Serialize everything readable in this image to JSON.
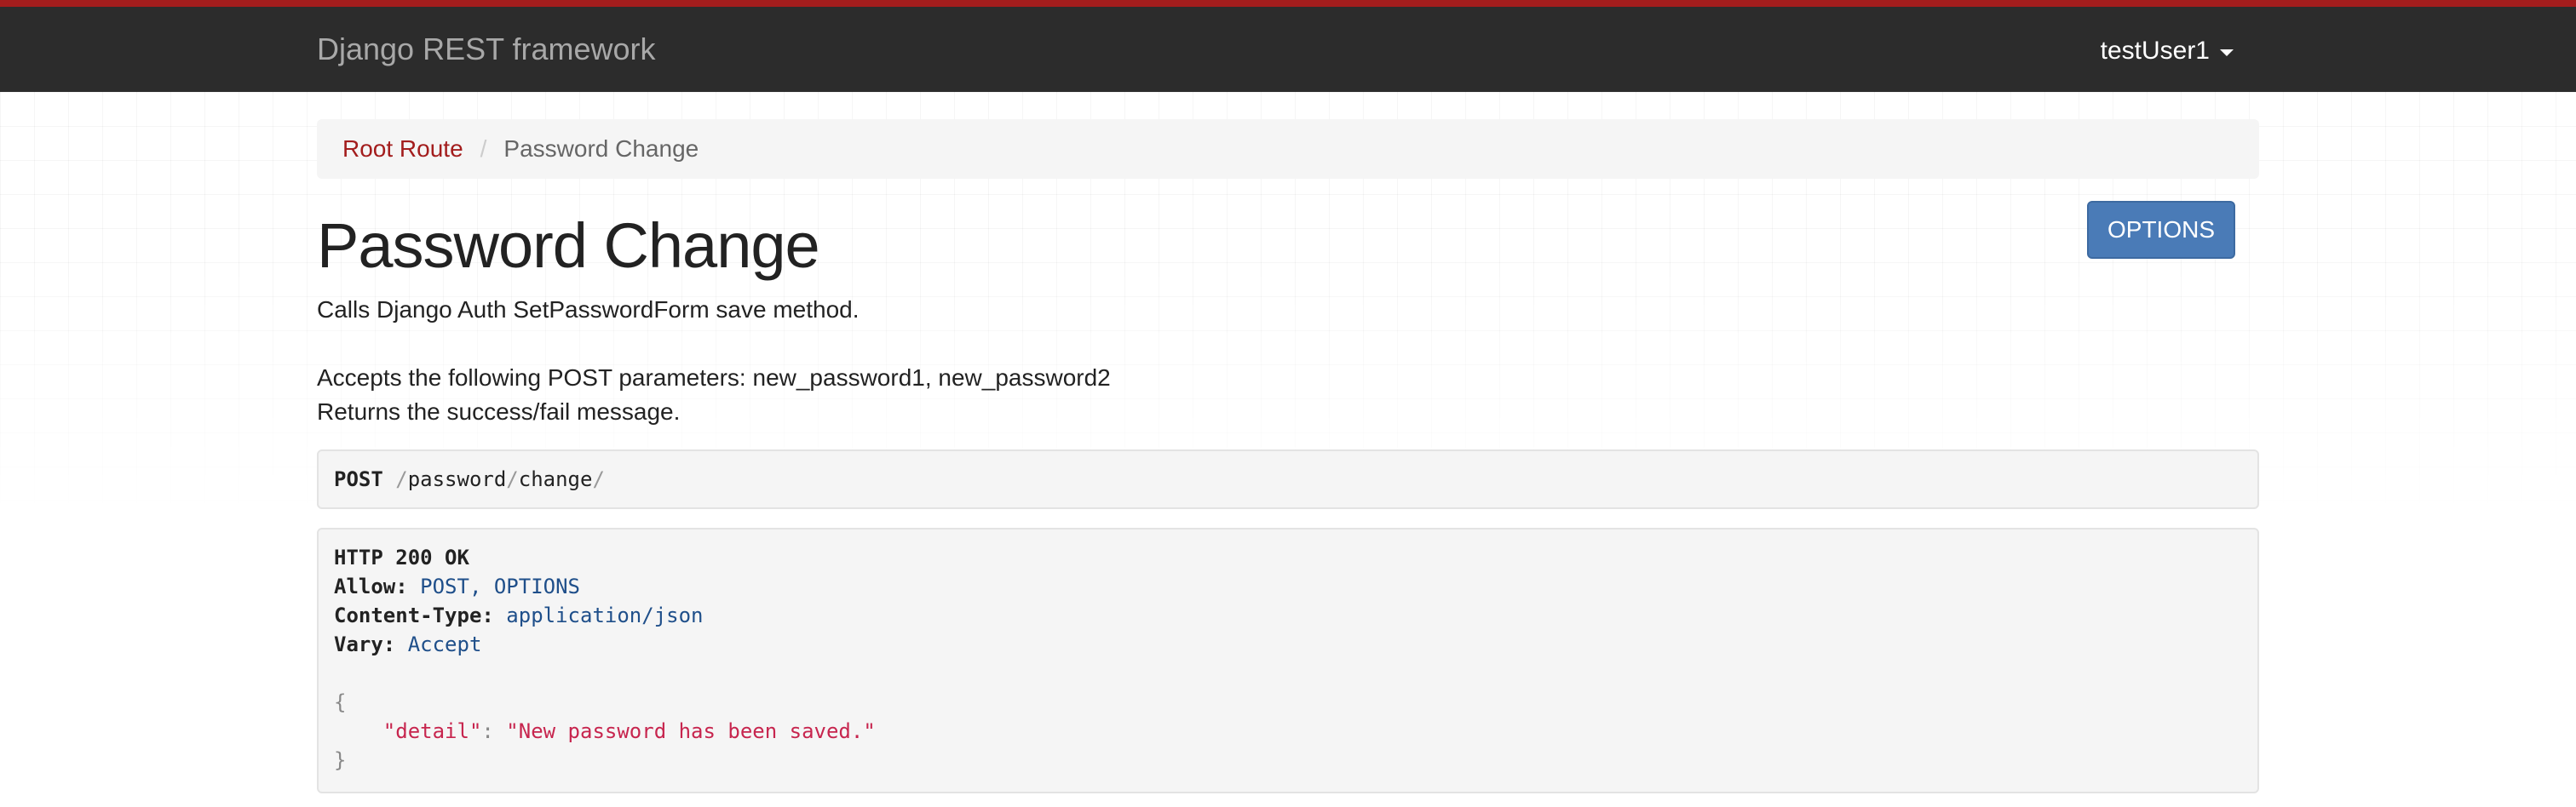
{
  "navbar": {
    "brand": "Django REST framework",
    "user": "testUser1",
    "accent_color": "#a31d1d"
  },
  "breadcrumb": {
    "root": "Root Route",
    "separator": "/",
    "current": "Password Change"
  },
  "page": {
    "title": "Password Change",
    "options_label": "OPTIONS",
    "description_line1": "Calls Django Auth SetPasswordForm save method.",
    "description_line2": "Accepts the following POST parameters: new_password1, new_password2",
    "description_line3": "Returns the success/fail message."
  },
  "request": {
    "method": "POST",
    "path_segments": [
      "password",
      "change"
    ]
  },
  "response": {
    "status": "HTTP 200 OK",
    "headers": [
      {
        "key": "Allow:",
        "value": "POST, OPTIONS"
      },
      {
        "key": "Content-Type:",
        "value": "application/json"
      },
      {
        "key": "Vary:",
        "value": "Accept"
      }
    ],
    "body_open": "{",
    "body_key": "\"detail\"",
    "body_colon": ":",
    "body_value": "\"New password has been saved.\"",
    "body_close": "}"
  }
}
